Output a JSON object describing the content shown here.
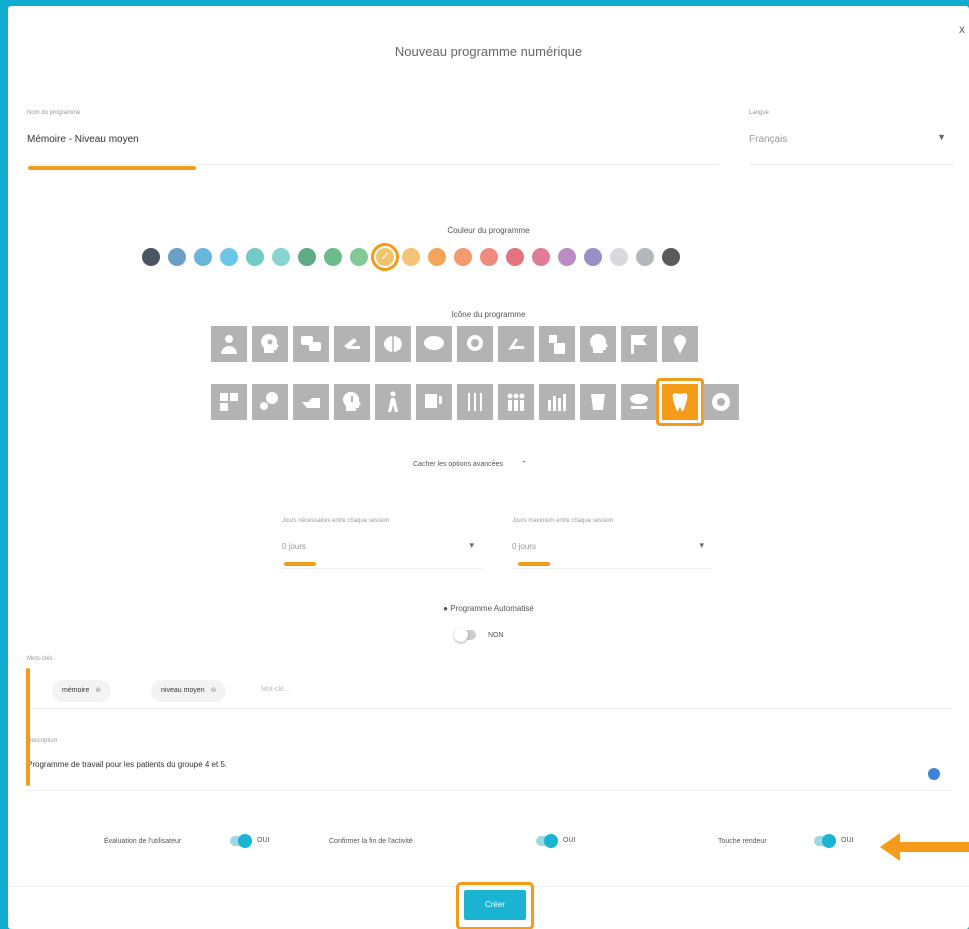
{
  "dialog": {
    "title": "Nouveau programme numérique",
    "close_label": "x"
  },
  "program_name": {
    "label": "Nom du programme",
    "value": "Mémoire - Niveau moyen"
  },
  "language": {
    "label": "Langue",
    "value": "Français"
  },
  "color_section": {
    "label": "Couleur du programme",
    "selected_index": 9,
    "colors": [
      "#4a5563",
      "#6a9fc6",
      "#68b6dc",
      "#6cc7e6",
      "#72cbc7",
      "#86d5cf",
      "#5fab86",
      "#6abd8b",
      "#82c993",
      "#f1c56a",
      "#f5c27a",
      "#f3a55c",
      "#f39a6f",
      "#ef8a7d",
      "#e5737f",
      "#e07b9a",
      "#bb8bc4",
      "#9a8ec9",
      "#d8d8dd",
      "#b4b8be",
      "#5b5b5b"
    ]
  },
  "icon_section": {
    "label": "Icône du programme",
    "selected_row": 1,
    "selected_col": 12,
    "row1": [
      "person-icon",
      "head-gear-icon",
      "chat-icon",
      "hand-icon",
      "brain-icon",
      "brain-side-icon",
      "brain-bubble-icon",
      "hand-point-icon",
      "body-icon",
      "head-shadow-icon",
      "flag-icon",
      "head-location-icon"
    ],
    "row2": [
      "puzzle-icon",
      "head-people-icon",
      "hand-open-icon",
      "head-exclamation-icon",
      "walking-person-icon",
      "speech-icon",
      "cutlery-icon",
      "family-icon",
      "bars-icon",
      "cup-icon",
      "mouth-bubble-icon",
      "tooth-icon",
      "gear-circle-icon"
    ]
  },
  "options_toggle": {
    "label": "Cacher les options avancées",
    "chevron": "chevron-up-icon"
  },
  "min_days": {
    "label": "Jours nécessaires entre chaque session",
    "value": "0 jours"
  },
  "max_days": {
    "label": "Jours maximum entre chaque session",
    "value": "0 jours"
  },
  "automatic_program": {
    "label": "Programme Automatisé",
    "value": "NON"
  },
  "keywords": {
    "label": "Mots-clés",
    "chips": [
      "mémoire",
      "niveau moyen"
    ],
    "placeholder": "Mot-clé..."
  },
  "description": {
    "label": "Description",
    "value": "Programme de travail pour les patients du groupe 4 et 5."
  },
  "toggles": [
    {
      "label": "Évaluation de l'utilisateur",
      "value": "OUI"
    },
    {
      "label": "Confirmer la fin de l'activité",
      "value": "OUI"
    },
    {
      "label": "Touche rendeur",
      "value": "OUI"
    }
  ],
  "submit": {
    "label": "Créer"
  },
  "colors": {
    "accent": "#1ab3d1",
    "highlight": "#f49b1a",
    "background": "#10acd0"
  }
}
